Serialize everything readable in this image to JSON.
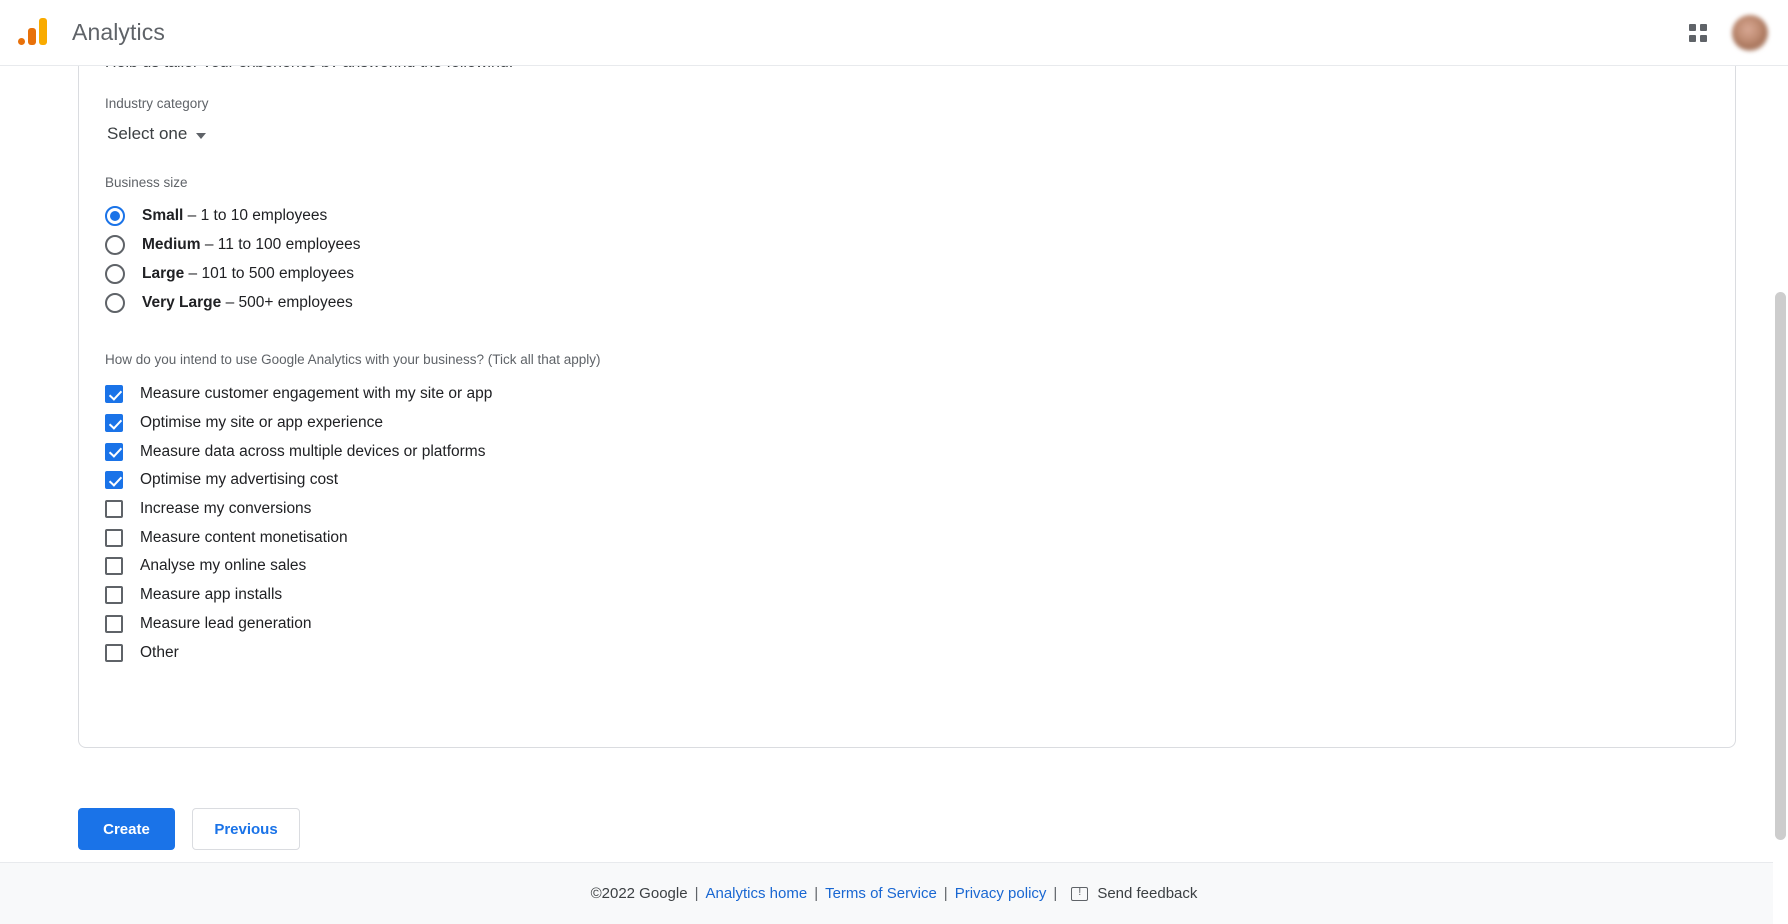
{
  "header": {
    "brand_title": "Analytics",
    "logo_name": "google-analytics-logo",
    "apps_icon": "apps-grid-icon",
    "avatar": "account-avatar"
  },
  "form": {
    "intro": "Help us tailor your experience by answering the following.",
    "industry": {
      "label": "Industry category",
      "selected": "Select one"
    },
    "business_size": {
      "label": "Business size",
      "options": [
        {
          "name": "Small",
          "detail": "– 1 to 10 employees",
          "checked": true
        },
        {
          "name": "Medium",
          "detail": "– 11 to 100 employees",
          "checked": false
        },
        {
          "name": "Large",
          "detail": "– 101 to 500 employees",
          "checked": false
        },
        {
          "name": "Very Large",
          "detail": "– 500+ employees",
          "checked": false
        }
      ]
    },
    "usage": {
      "question": "How do you intend to use Google Analytics with your business? (Tick all that apply)",
      "options": [
        {
          "label": "Measure customer engagement with my site or app",
          "checked": true
        },
        {
          "label": "Optimise my site or app experience",
          "checked": true
        },
        {
          "label": "Measure data across multiple devices or platforms",
          "checked": true
        },
        {
          "label": "Optimise my advertising cost",
          "checked": true
        },
        {
          "label": "Increase my conversions",
          "checked": false
        },
        {
          "label": "Measure content monetisation",
          "checked": false
        },
        {
          "label": "Analyse my online sales",
          "checked": false
        },
        {
          "label": "Measure app installs",
          "checked": false
        },
        {
          "label": "Measure lead generation",
          "checked": false
        },
        {
          "label": "Other",
          "checked": false
        }
      ]
    }
  },
  "actions": {
    "create_label": "Create",
    "previous_label": "Previous"
  },
  "footer": {
    "copyright": "©2022 Google",
    "analytics_home": "Analytics home",
    "terms": "Terms of Service",
    "privacy": "Privacy policy",
    "send_feedback": "Send feedback",
    "separator": "|"
  },
  "colors": {
    "accent": "#1a73e8",
    "logo_orange": "#F9AB00",
    "logo_dark_orange": "#E8710A",
    "link": "#1967d2"
  }
}
